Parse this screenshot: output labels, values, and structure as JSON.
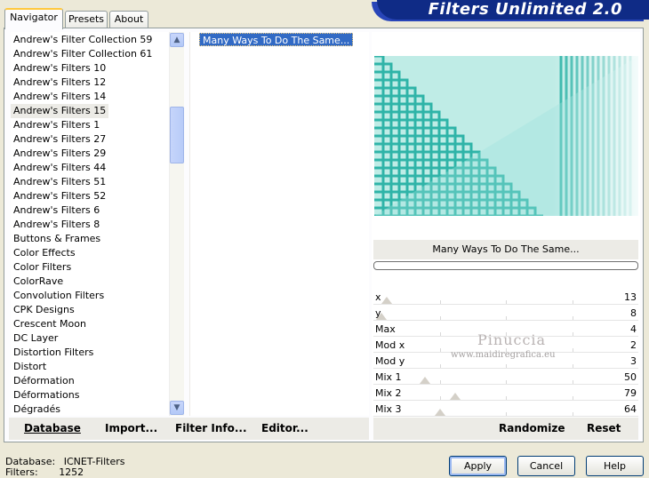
{
  "banner": {
    "title": "Filters Unlimited 2.0"
  },
  "tabs": [
    {
      "label": "Navigator",
      "active": true
    },
    {
      "label": "Presets",
      "active": false
    },
    {
      "label": "About",
      "active": false
    }
  ],
  "categories": {
    "selected_index": 5,
    "items": [
      "Andrew's Filter Collection 59",
      "Andrew's Filter Collection 61",
      "Andrew's Filters 10",
      "Andrew's Filters 12",
      "Andrew's Filters 14",
      "Andrew's Filters 15",
      "Andrew's Filters 1",
      "Andrew's Filters 27",
      "Andrew's Filters 29",
      "Andrew's Filters 44",
      "Andrew's Filters 51",
      "Andrew's Filters 52",
      "Andrew's Filters 6",
      "Andrew's Filters 8",
      "Buttons & Frames",
      "Color Effects",
      "Color Filters",
      "ColorRave",
      "Convolution Filters",
      "CPK Designs",
      "Crescent Moon",
      "DC Layer",
      "Distortion Filters",
      "Distort",
      "Déformation",
      "Déformations",
      "Dégradés"
    ]
  },
  "filters": {
    "items": [
      "Many Ways To Do The Same..."
    ]
  },
  "preview": {
    "filter_title": "Many Ways To Do The Same...",
    "progress": 0
  },
  "params": [
    {
      "name": "x",
      "value": "13",
      "pos": 0.05
    },
    {
      "name": "y",
      "value": "8",
      "pos": 0.03
    },
    {
      "name": "Max",
      "value": "4",
      "pos": null
    },
    {
      "name": "Mod x",
      "value": "2",
      "pos": null
    },
    {
      "name": "Mod y",
      "value": "3",
      "pos": null
    },
    {
      "name": "Mix 1",
      "value": "50",
      "pos": 0.196
    },
    {
      "name": "Mix 2",
      "value": "79",
      "pos": 0.31
    },
    {
      "name": "Mix 3",
      "value": "64",
      "pos": 0.25
    }
  ],
  "left_buttons": {
    "database": "Database",
    "import": "Import...",
    "filter_info": "Filter Info...",
    "editor": "Editor..."
  },
  "right_buttons": {
    "randomize": "Randomize",
    "reset": "Reset"
  },
  "status": {
    "database_label": "Database:",
    "database_value": "ICNET-Filters",
    "filters_label": "Filters:",
    "filters_value": "1252"
  },
  "dialog_buttons": {
    "apply": "Apply",
    "cancel": "Cancel",
    "help": "Help"
  },
  "watermark": {
    "line1": "Pinuccia",
    "line2": "www.maidiregrafica.eu"
  },
  "colors": {
    "accent": "#316ac5",
    "banner": "#0f2b86",
    "preview_teal": "#3cb8b0"
  }
}
